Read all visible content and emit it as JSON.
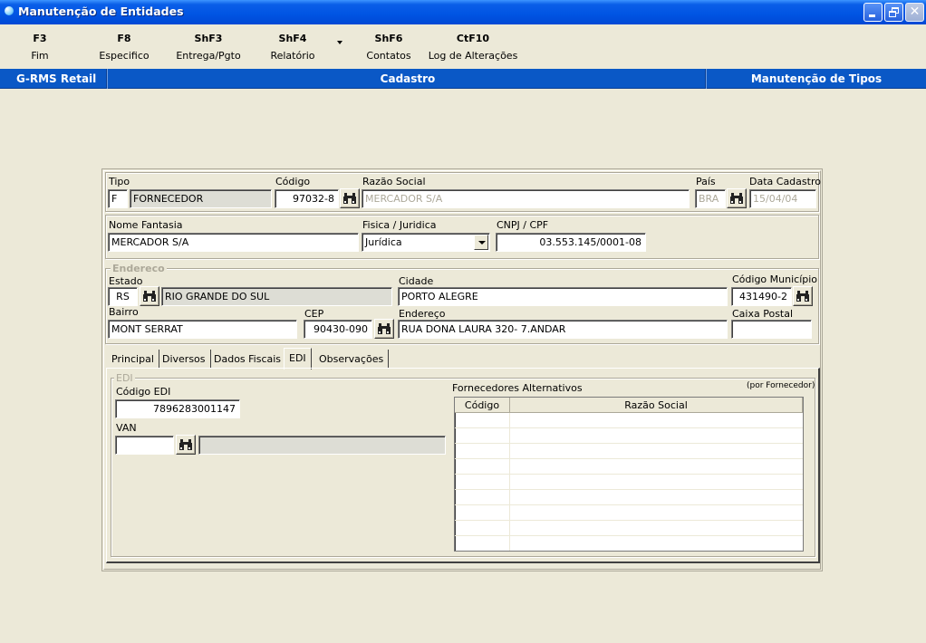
{
  "window": {
    "title": "Manutenção de Entidades"
  },
  "toolbar": {
    "keys": [
      {
        "key": "F3",
        "label": "Fim"
      },
      {
        "key": "F8",
        "label": "Especifico"
      },
      {
        "key": "ShF3",
        "label": "Entrega/Pgto"
      },
      {
        "key": "ShF4",
        "label": "Relatório"
      },
      {
        "key": "ShF6",
        "label": "Contatos"
      },
      {
        "key": "CtF10",
        "label": "Log de Alterações"
      }
    ]
  },
  "header": {
    "left": "G-RMS Retail",
    "center": "Cadastro",
    "right": "Manutenção de Tipos"
  },
  "form": {
    "tipo": {
      "label": "Tipo",
      "code": "F",
      "description": "FORNECEDOR"
    },
    "codigo": {
      "label": "Código",
      "value": "97032-8"
    },
    "razao_social": {
      "label": "Razão Social",
      "value": "MERCADOR S/A"
    },
    "pais": {
      "label": "País",
      "value": "BRA"
    },
    "data_cadastro": {
      "label": "Data Cadastro",
      "value": "15/04/04"
    },
    "nome_fantasia": {
      "label": "Nome Fantasia",
      "value": "MERCADOR S/A"
    },
    "fisica_juridica": {
      "label": "Fisica / Juridica",
      "value": "Jurídica"
    },
    "cnpj_cpf": {
      "label": "CNPJ / CPF",
      "value": "03.553.145/0001-08"
    }
  },
  "endereco": {
    "group_label": "Endereco",
    "estado": {
      "label": "Estado",
      "code": "RS",
      "name": "RIO GRANDE DO SUL"
    },
    "cidade": {
      "label": "Cidade",
      "value": "PORTO ALEGRE"
    },
    "codigo_municipio": {
      "label": "Código Município",
      "value": "431490-2"
    },
    "bairro": {
      "label": "Bairro",
      "value": "MONT SERRAT"
    },
    "cep": {
      "label": "CEP",
      "value": "90430-090"
    },
    "endereco": {
      "label": "Endereço",
      "value": "RUA DONA LAURA 320- 7.ANDAR"
    },
    "caixa_postal": {
      "label": "Caixa Postal",
      "value": ""
    }
  },
  "tabs": [
    {
      "label": "Principal",
      "active": false
    },
    {
      "label": "Diversos",
      "active": false
    },
    {
      "label": "Dados Fiscais",
      "active": false
    },
    {
      "label": "EDI",
      "active": true
    },
    {
      "label": "Observações",
      "active": false
    }
  ],
  "edi": {
    "group_label": "EDI",
    "codigo_edi": {
      "label": "Código EDI",
      "value": "7896283001147"
    },
    "van": {
      "label": "VAN",
      "value": "",
      "description": ""
    }
  },
  "alternativos": {
    "title": "Fornecedores Alternativos",
    "note": "(por Fornecedor)",
    "columns": [
      "Código",
      "Razão Social"
    ],
    "rows": []
  },
  "icons": {
    "search": "binoculars-icon",
    "dropdown": "chevron-down-icon"
  },
  "colors": {
    "header_blue": "#0a58c6",
    "titlebar_blue": "#0054e3",
    "background": "#ece9d8"
  }
}
